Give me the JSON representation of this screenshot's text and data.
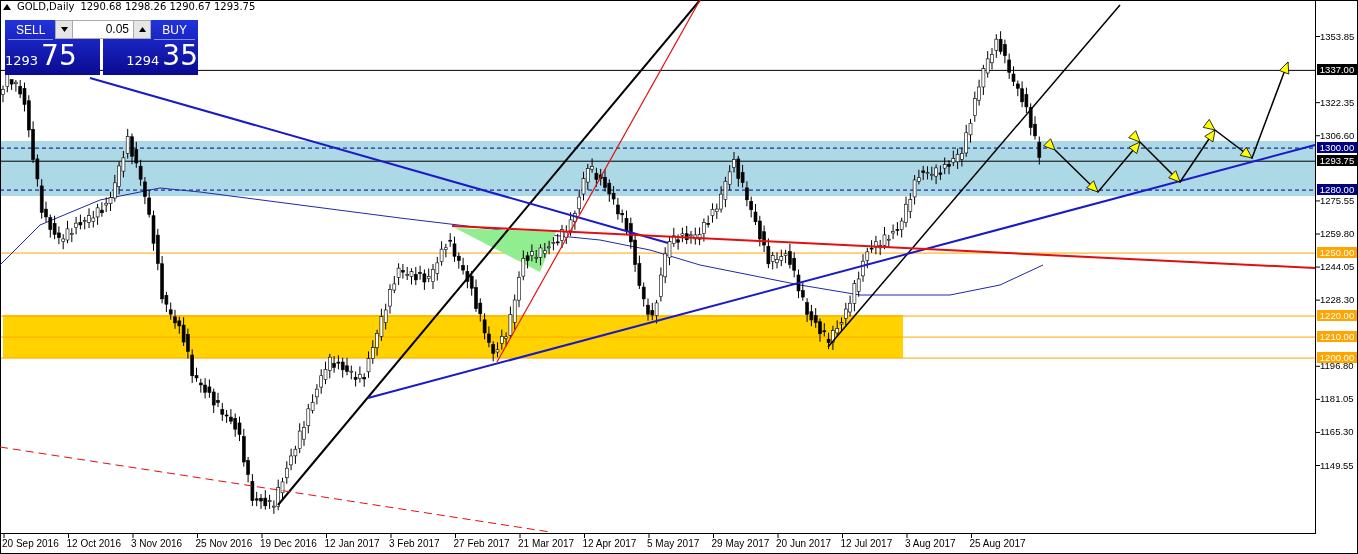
{
  "symbol_bar": {
    "title": "GOLD,Daily",
    "ohlc": "1290.68 1298.26 1290.67 1293.75"
  },
  "trade_panel": {
    "sell": {
      "label": "SELL",
      "price_small": "1293",
      "price_big": "75"
    },
    "lot": {
      "value": "0.05"
    },
    "buy": {
      "label": "BUY",
      "price_small": "1294",
      "price_big": "35"
    }
  },
  "price_axis": [
    {
      "label": "1353.85",
      "kind": "tick"
    },
    {
      "label": "1337.00",
      "kind": "marker",
      "color": "#000000"
    },
    {
      "label": "1322.35",
      "kind": "tick"
    },
    {
      "label": "1306.60",
      "kind": "tick"
    },
    {
      "label": "1300.00",
      "kind": "marker",
      "color": "#000080"
    },
    {
      "label": "1293.75",
      "kind": "marker",
      "color": "#000000"
    },
    {
      "label": "1280.00",
      "kind": "marker",
      "color": "#000080"
    },
    {
      "label": "1275.55",
      "kind": "tick"
    },
    {
      "label": "1259.80",
      "kind": "tick"
    },
    {
      "label": "1250.00",
      "kind": "marker",
      "color": "#ffa500"
    },
    {
      "label": "1244.05",
      "kind": "tick"
    },
    {
      "label": "1228.30",
      "kind": "tick"
    },
    {
      "label": "1220.00",
      "kind": "marker",
      "color": "#ffa500"
    },
    {
      "label": "1210.00",
      "kind": "marker",
      "color": "#ffa500"
    },
    {
      "label": "1200.00",
      "kind": "marker",
      "color": "#ffa500"
    },
    {
      "label": "1196.80",
      "kind": "tick"
    },
    {
      "label": "1181.05",
      "kind": "tick"
    },
    {
      "label": "1165.30",
      "kind": "tick"
    },
    {
      "label": "1149.55",
      "kind": "tick"
    }
  ],
  "time_axis": [
    "20 Sep 2016",
    "12 Oct 2016",
    "3 Nov 2016",
    "25 Nov 2016",
    "19 Dec 2016",
    "12 Jan 2017",
    "3 Feb 2017",
    "27 Feb 2017",
    "21 Mar 2017",
    "12 Apr 2017",
    "5 May 2017",
    "29 May 2017",
    "20 Jun 2017",
    "12 Jul 2017",
    "3 Aug 2017",
    "25 Aug 2017"
  ]
}
